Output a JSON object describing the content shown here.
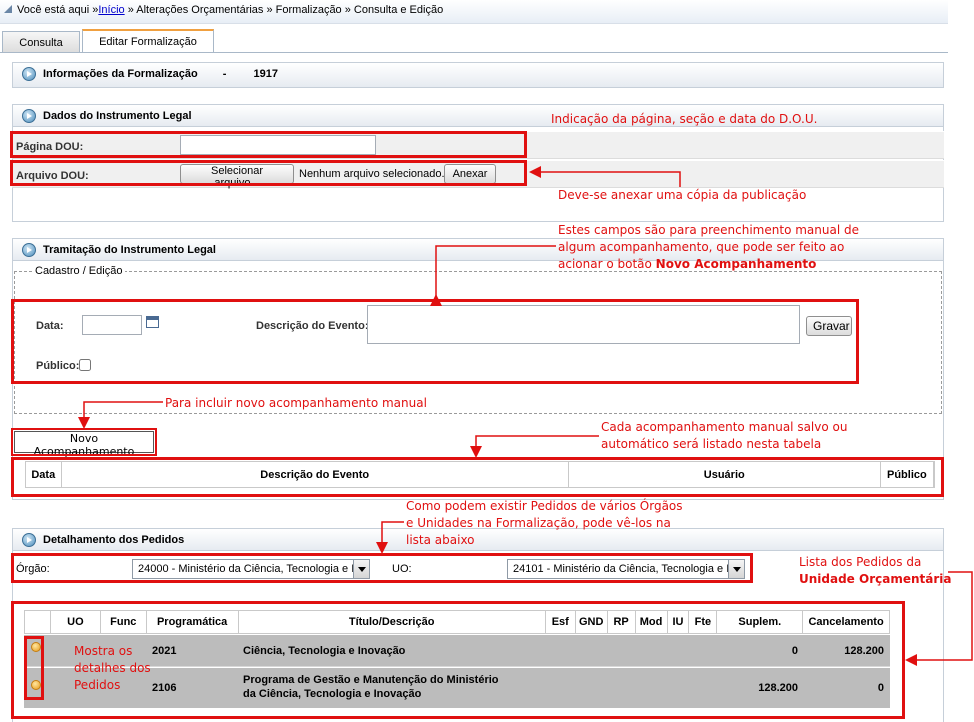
{
  "breadcrumb": {
    "prefix": "Você está aqui »",
    "home": "Início",
    "rest": " » Alterações Orçamentárias » Formalização » Consulta e Edição"
  },
  "tabs": [
    {
      "label": "Consulta"
    },
    {
      "label": "Editar Formalização"
    }
  ],
  "info": {
    "title": "Informações da Formalização",
    "sep": "-",
    "number": "1917"
  },
  "dados": {
    "title": "Dados do Instrumento Legal",
    "pagina_label": "Página DOU:",
    "pagina_value": "",
    "arquivo_label": "Arquivo DOU:",
    "select_file_btn": "Selecionar arquivo...",
    "no_file": "Nenhum arquivo selecionado.",
    "attach_btn": "Anexar"
  },
  "tramitacao": {
    "title": "Tramitação do Instrumento Legal",
    "fieldset": "Cadastro / Edição",
    "data_label": "Data:",
    "data_value": "",
    "descricao_label": "Descrição do Evento:",
    "descricao_value": "",
    "gravar_btn": "Gravar",
    "publico_label": "Público:",
    "novo_btn": "Novo Acompanhamento",
    "table_headers": [
      "Data",
      "Descrição do Evento",
      "Usuário",
      "Público"
    ]
  },
  "pedidos": {
    "title": "Detalhamento dos Pedidos",
    "orgao_label": "Órgão:",
    "orgao_value": "24000 - Ministério da Ciência, Tecnologia e In",
    "uo_label": "UO:",
    "uo_value": "24101 - Ministério da Ciência, Tecnologia e In",
    "headers": [
      "UO",
      "Func",
      "Programática",
      "Título/Descrição",
      "Esf",
      "GND",
      "RP",
      "Mod",
      "IU",
      "Fte",
      "Suplem.",
      "Cancelamento"
    ],
    "rows": [
      {
        "programatica": "2021",
        "titulo": "Ciência, Tecnologia e Inovação",
        "suplem": "0",
        "cancelamento": "128.200"
      },
      {
        "programatica": "2106",
        "titulo": "Programa de Gestão e Manutenção do Ministério da Ciência, Tecnologia e Inovação",
        "suplem": "128.200",
        "cancelamento": "0"
      }
    ]
  },
  "annotations": {
    "a1": "Indicação da página, seção e data do D.O.U.",
    "a2": "Deve-se anexar uma cópia da publicação",
    "a3_l1": "Estes campos são para preenchimento manual de",
    "a3_l2": "algum acompanhamento, que pode ser feito ao",
    "a3_l3": "acionar o botão ",
    "a3_bold": "Novo Acompanhamento",
    "a4": "Para incluir novo acompanhamento manual",
    "a5_l1": "Cada acompanhamento manual salvo ou",
    "a5_l2": "automático será listado nesta tabela",
    "a6_l1": "Como podem existir Pedidos de vários Órgãos",
    "a6_l2": "e Unidades na Formalização, pode vê-los na",
    "a6_l3": "lista abaixo",
    "a7_l1": "Lista dos Pedidos da",
    "a7_bold": "Unidade Orçamentária",
    "a8_l1": "Mostra os",
    "a8_l2": "detalhes dos",
    "a8_l3": "Pedidos"
  }
}
